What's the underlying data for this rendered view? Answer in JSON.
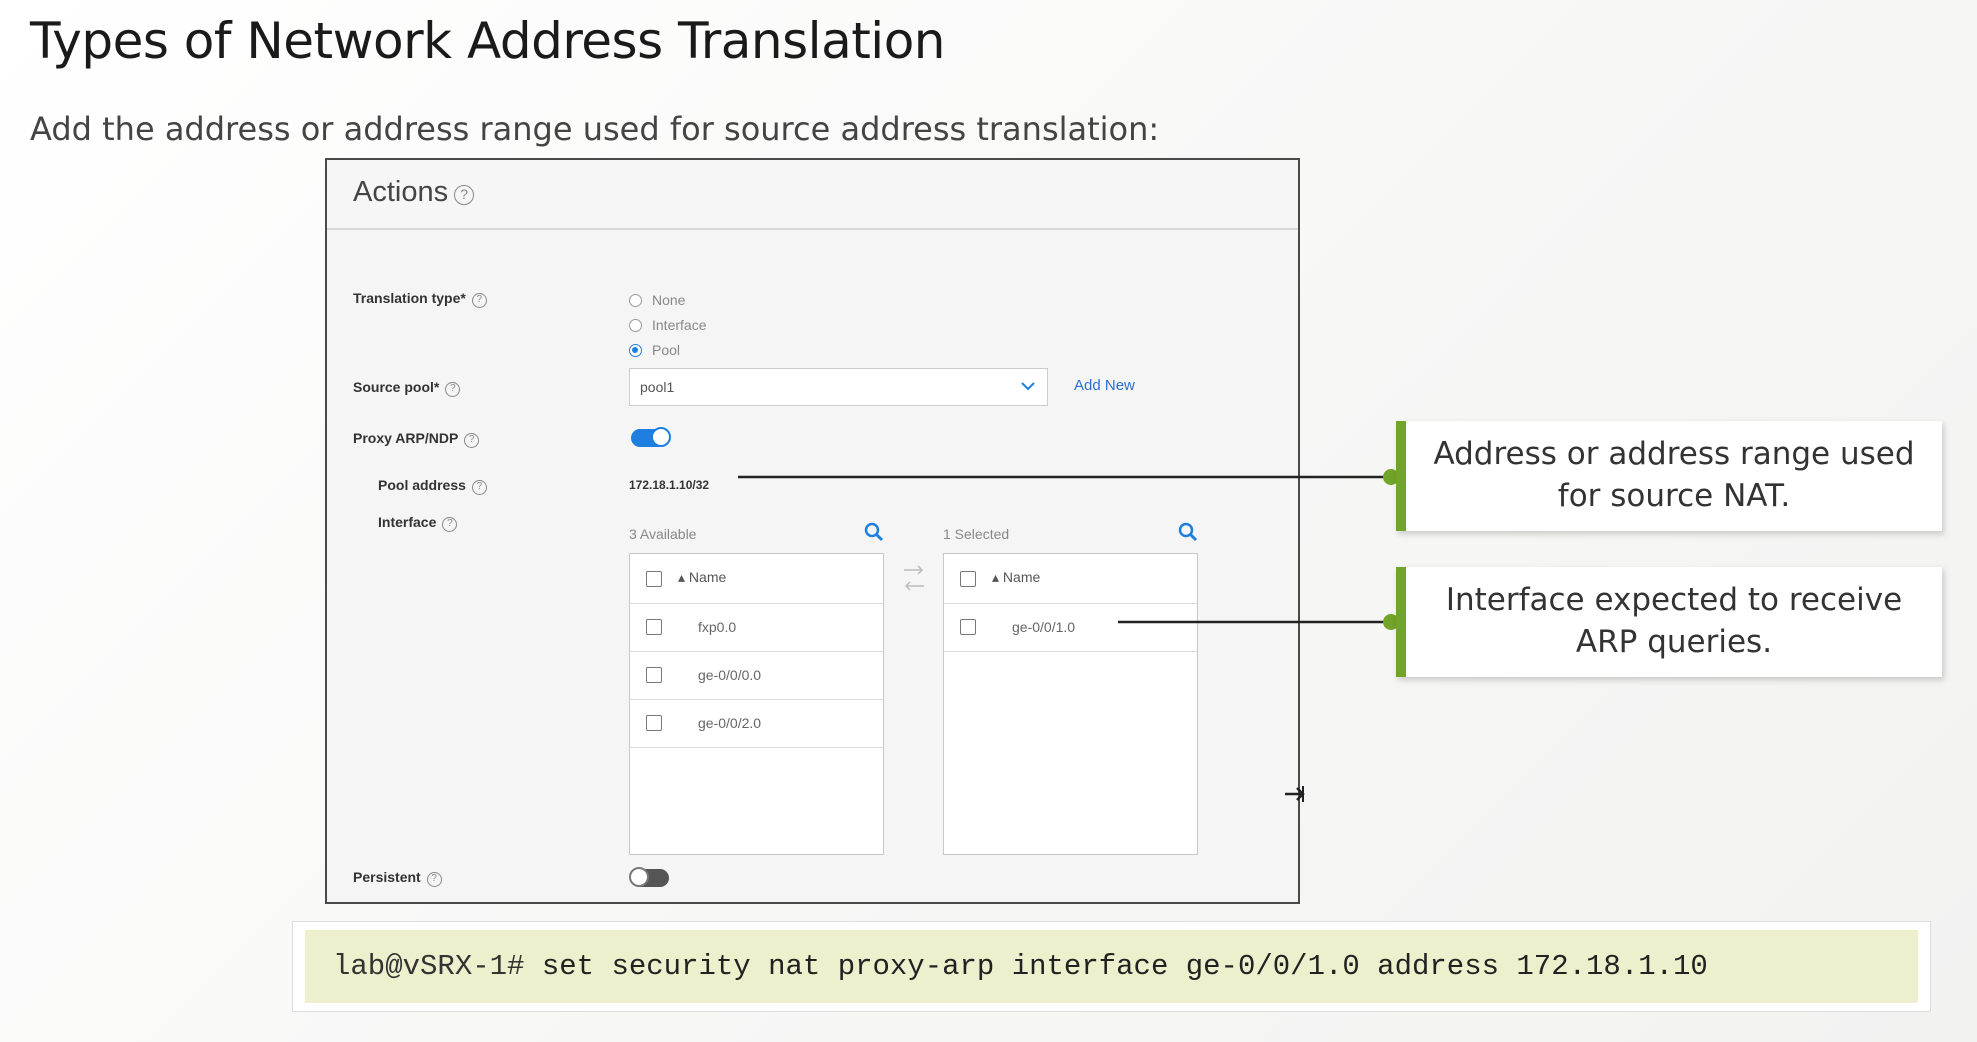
{
  "slide": {
    "title": "Types of Network Address Translation",
    "subtitle": "Add the address or address range used for source address translation:"
  },
  "panel": {
    "title": "Actions",
    "help_glyph": "?",
    "fields": {
      "translation_type": {
        "label": "Translation type*",
        "options": [
          "None",
          "Interface",
          "Pool"
        ],
        "selected": "Pool"
      },
      "source_pool": {
        "label": "Source pool*",
        "value": "pool1",
        "add_new": "Add New"
      },
      "proxy_arp": {
        "label": "Proxy ARP/NDP",
        "enabled": true
      },
      "pool_address": {
        "label": "Pool address",
        "value": "172.18.1.10/32"
      },
      "interface": {
        "label": "Interface"
      },
      "persistent": {
        "label": "Persistent",
        "enabled": false
      }
    },
    "available_list": {
      "caption": "3 Available",
      "header": "▴ Name",
      "items": [
        "fxp0.0",
        "ge-0/0/0.0",
        "ge-0/0/2.0"
      ]
    },
    "selected_list": {
      "caption": "1 Selected",
      "header": "▴ Name",
      "items": [
        "ge-0/0/1.0"
      ]
    }
  },
  "callouts": [
    "Address or address range used for source NAT.",
    "Interface expected to receive ARP queries."
  ],
  "command": {
    "prompt": "lab@vSRX-1#",
    "text": " set security nat proxy-arp interface ge-0/0/1.0 address 172.18.1.10"
  },
  "colors": {
    "accent": "#1e7fe0",
    "callout_bar": "#72a32a",
    "command_bg": "#eeefcc"
  }
}
